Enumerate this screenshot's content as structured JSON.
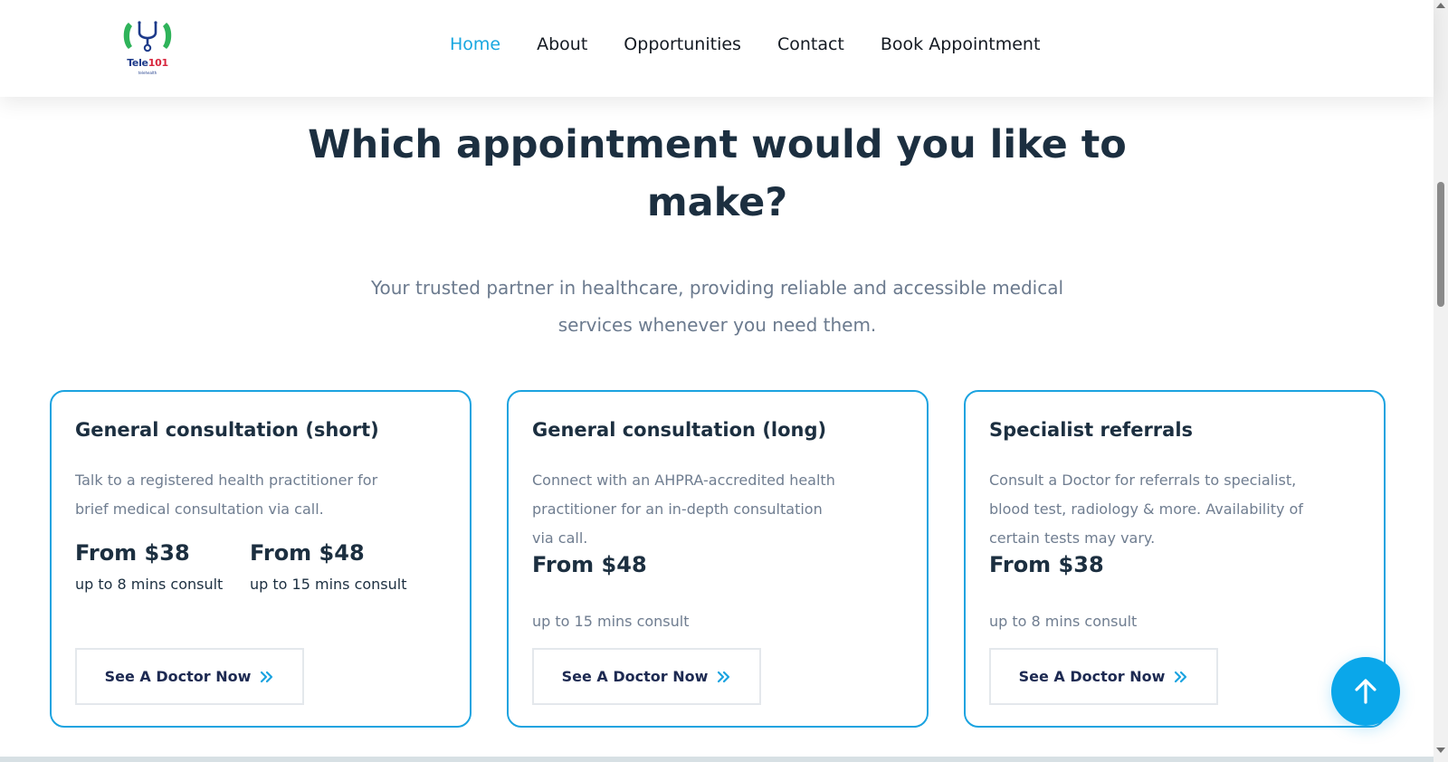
{
  "brand": {
    "logo_text_a": "Tele",
    "logo_text_b": "101",
    "logo_sub": "telehealth"
  },
  "nav": {
    "items": [
      {
        "label": "Home",
        "active": true
      },
      {
        "label": "About"
      },
      {
        "label": "Opportunities"
      },
      {
        "label": "Contact"
      },
      {
        "label": "Book Appointment"
      }
    ]
  },
  "hero": {
    "title_line1": "Which appointment would you like to",
    "title_line2": "make?",
    "subtitle_line1": "Your trusted partner in healthcare, providing reliable and accessible medical",
    "subtitle_line2": "services whenever you need them."
  },
  "cards": [
    {
      "title": "General consultation (short)",
      "desc_lines": [
        "Talk to a registered health practitioner for",
        "brief medical consultation via call."
      ],
      "prices": [
        {
          "price": "From $38",
          "duration": "up to 8 mins consult"
        },
        {
          "price": "From $48",
          "duration": "up to 15 mins consult"
        }
      ],
      "button": "See A Doctor Now"
    },
    {
      "title": "General consultation (long)",
      "desc_lines": [
        "Connect with an AHPRA-accredited health",
        "practitioner for an in-depth consultation",
        "via call."
      ],
      "prices": [
        {
          "price": "From $48",
          "duration": "up to 15 mins consult"
        }
      ],
      "button": "See A Doctor Now"
    },
    {
      "title": "Specialist referrals",
      "desc_lines": [
        "Consult a Doctor for referrals to specialist,",
        "blood test, radiology & more. Availability of",
        "certain tests may vary."
      ],
      "prices": [
        {
          "price": "From $38",
          "duration": "up to 8 mins consult"
        }
      ],
      "button": "See A Doctor Now"
    }
  ],
  "colors": {
    "accent": "#18a7e0",
    "card_border": "#1ba3e0",
    "heading": "#1c2f40",
    "muted": "#6f7d90",
    "button_text": "#1d2a52",
    "logo_green": "#2fb35a",
    "logo_blue": "#1d3a8a",
    "logo_red": "#d7263d"
  },
  "icons": {
    "chevron": "double-chevron-right-icon",
    "scroll_top": "arrow-up-icon",
    "logo": "stethoscope-phone-icon"
  }
}
